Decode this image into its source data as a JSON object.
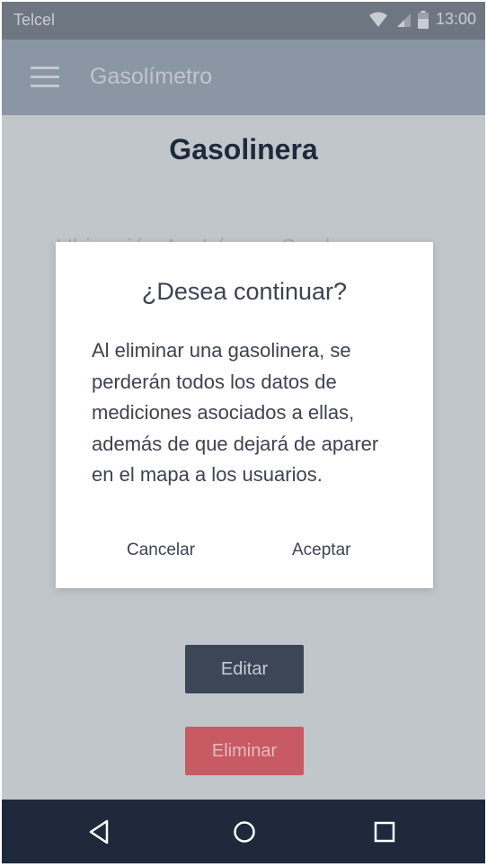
{
  "status_bar": {
    "carrier": "Telcel",
    "time": "13:00",
    "icons": [
      "wifi-icon",
      "signal-icon",
      "battery-icon"
    ]
  },
  "app_bar": {
    "menu_icon": "menu-icon",
    "title": "Gasolímetro"
  },
  "main": {
    "page_title": "Gasolinera",
    "obscured_text": "Ubicación Av. Lázaro Cardenas",
    "edit_label": "Editar",
    "delete_label": "Eliminar"
  },
  "dialog": {
    "title": "¿Desea continuar?",
    "message": "Al eliminar una gasolinera, se perderán todos los datos de mediciones asociados a ellas, además de que dejará de aparer en el mapa a los usuarios.",
    "cancel_label": "Cancelar",
    "accept_label": "Aceptar"
  },
  "nav_bar": {
    "icons": [
      "back-icon",
      "home-icon",
      "recents-icon"
    ]
  },
  "colors": {
    "status_bar": "#6e7682",
    "app_bar": "#8b96a4",
    "scrim_background": "#c1c6cb",
    "primary_dark": "#1e2a3c",
    "edit_button": "#3c4656",
    "delete_button": "#c85a63"
  }
}
